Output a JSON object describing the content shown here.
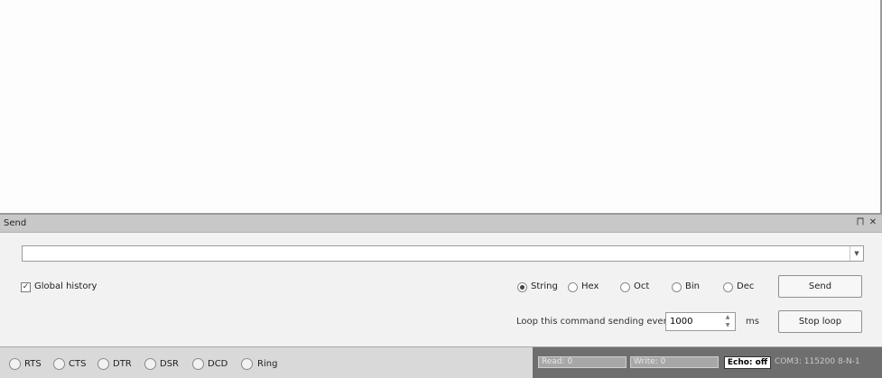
{
  "send_panel": {
    "title": "Send",
    "pin_glyph": "⨅",
    "close_glyph": "✕",
    "command_value": "",
    "global_history": {
      "label": "Global history",
      "checked": true,
      "mark": "✓"
    },
    "formats": [
      {
        "label": "String",
        "selected": true
      },
      {
        "label": "Hex",
        "selected": false
      },
      {
        "label": "Oct",
        "selected": false
      },
      {
        "label": "Bin",
        "selected": false
      },
      {
        "label": "Dec",
        "selected": false
      }
    ],
    "send_button": "Send",
    "loop_label": "Loop this command sending every",
    "loop_value": "1000",
    "loop_unit": "ms",
    "stop_loop_button": "Stop loop"
  },
  "status_bar": {
    "signals": [
      "RTS",
      "CTS",
      "DTR",
      "DSR",
      "DCD",
      "Ring"
    ],
    "read": "Read: 0",
    "write": "Write: 0",
    "echo": "Echo: off",
    "port": "COM3: 115200 8-N-1"
  }
}
